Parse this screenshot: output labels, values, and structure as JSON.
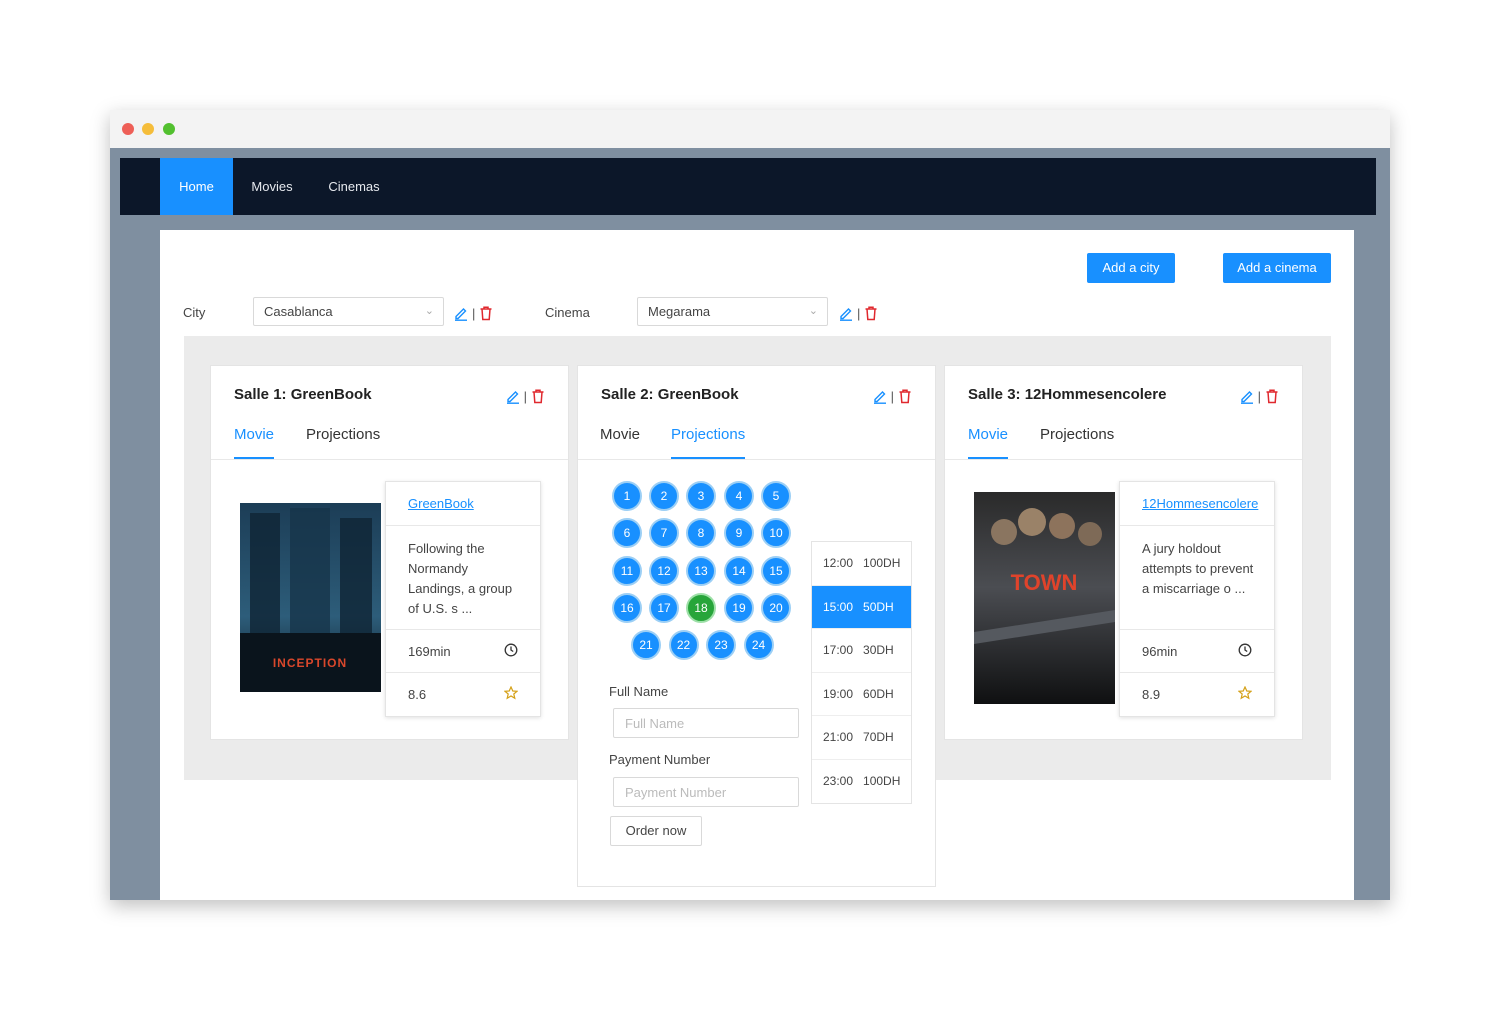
{
  "nav": {
    "items": [
      "Home",
      "Movies",
      "Cinemas"
    ],
    "active": "Home"
  },
  "actions": {
    "add_city": "Add a city",
    "add_cinema": "Add a cinema"
  },
  "filters": {
    "city_label": "City",
    "city_value": "Casablanca",
    "cinema_label": "Cinema",
    "cinema_value": "Megarama"
  },
  "halls": [
    {
      "title": "Salle 1: GreenBook",
      "tabs": [
        "Movie",
        "Projections"
      ],
      "active_tab": "Movie",
      "movie": {
        "title": "GreenBook",
        "description": "Following the Normandy Landings, a group of U.S. s ...",
        "duration": "169min",
        "rating": "8.6",
        "poster_text": "INCEPTION"
      }
    },
    {
      "title": "Salle 2: GreenBook",
      "tabs": [
        "Movie",
        "Projections"
      ],
      "active_tab": "Projections",
      "seats": [
        "1",
        "2",
        "3",
        "4",
        "5",
        "6",
        "7",
        "8",
        "9",
        "10",
        "11",
        "12",
        "13",
        "14",
        "15",
        "16",
        "17",
        "18",
        "19",
        "20",
        "21",
        "22",
        "23",
        "24"
      ],
      "selected_seat": "18",
      "times": [
        {
          "time": "12:00",
          "price": "100DH"
        },
        {
          "time": "15:00",
          "price": "50DH"
        },
        {
          "time": "17:00",
          "price": "30DH"
        },
        {
          "time": "19:00",
          "price": "60DH"
        },
        {
          "time": "21:00",
          "price": "70DH"
        },
        {
          "time": "23:00",
          "price": "100DH"
        }
      ],
      "selected_time": "15:00",
      "form": {
        "full_name_label": "Full Name",
        "full_name_placeholder": "Full Name",
        "payment_label": "Payment Number",
        "payment_placeholder": "Payment Number",
        "submit": "Order now"
      }
    },
    {
      "title": "Salle 3: 12Hommesencolere",
      "tabs": [
        "Movie",
        "Projections"
      ],
      "active_tab": "Movie",
      "movie": {
        "title": "12Hommesencolere",
        "description": "A jury holdout attempts to prevent a miscarriage o ...",
        "duration": "96min",
        "rating": "8.9",
        "poster_text": "TOWN"
      }
    }
  ],
  "colors": {
    "primary": "#1890ff",
    "navbar": "#0c1729",
    "danger": "#e0282e",
    "star": "#d4a017",
    "seat_selected": "#27a53a"
  }
}
